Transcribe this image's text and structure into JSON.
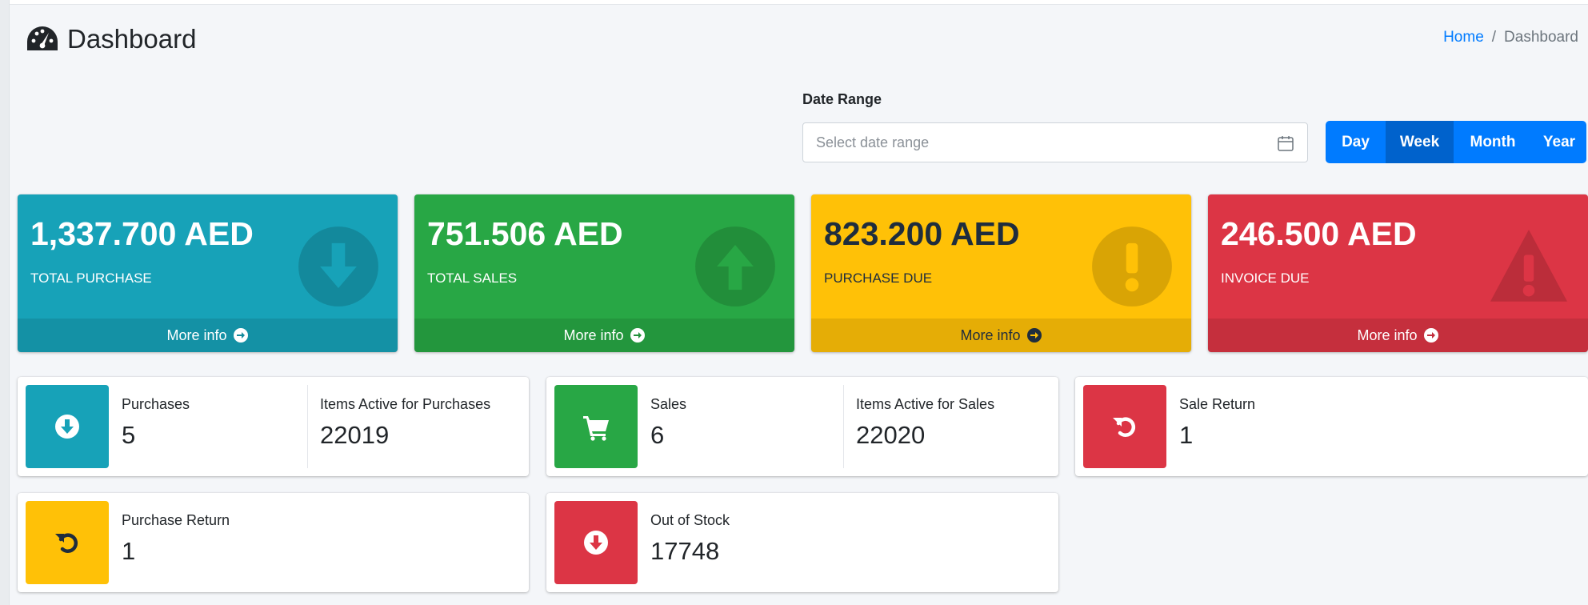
{
  "header": {
    "title": "Dashboard",
    "title_icon": "tachometer-icon",
    "breadcrumb": {
      "home": "Home",
      "separator": "/",
      "current": "Dashboard"
    }
  },
  "date_range": {
    "label": "Date Range",
    "placeholder": "Select date range",
    "icon": "calendar-icon",
    "buttons": [
      {
        "label": "Day",
        "active": false
      },
      {
        "label": "Week",
        "active": true
      },
      {
        "label": "Month",
        "active": false
      },
      {
        "label": "Year",
        "active": false
      }
    ],
    "accent_color": "#007bff"
  },
  "stat_boxes": [
    {
      "value": "1,337.700 AED",
      "label": "TOTAL PURCHASE",
      "footer": "More info",
      "icon": "arrow-circle-down-icon",
      "color": "#17a2b8"
    },
    {
      "value": "751.506 AED",
      "label": "TOTAL SALES",
      "footer": "More info",
      "icon": "arrow-circle-up-icon",
      "color": "#28a745"
    },
    {
      "value": "823.200 AED",
      "label": "PURCHASE DUE",
      "footer": "More info",
      "icon": "exclamation-circle-icon",
      "color": "#ffc107"
    },
    {
      "value": "246.500 AED",
      "label": "INVOICE DUE",
      "footer": "More info",
      "icon": "warning-triangle-icon",
      "color": "#dc3545"
    }
  ],
  "info_boxes": {
    "purchases": {
      "label": "Purchases",
      "value": "5",
      "secondary_label": "Items Active for Purchases",
      "secondary_value": "22019",
      "icon": "arrow-circle-down-icon",
      "color": "#17a2b8"
    },
    "sales": {
      "label": "Sales",
      "value": "6",
      "secondary_label": "Items Active for Sales",
      "secondary_value": "22020",
      "icon": "shopping-cart-icon",
      "color": "#28a745"
    },
    "sale_return": {
      "label": "Sale Return",
      "value": "1",
      "icon": "undo-icon",
      "color": "#dc3545"
    },
    "purchase_return": {
      "label": "Purchase Return",
      "value": "1",
      "icon": "undo-icon",
      "color": "#ffc107"
    },
    "out_of_stock": {
      "label": "Out of Stock",
      "value": "17748",
      "icon": "arrow-circle-down-icon",
      "color": "#dc3545"
    }
  }
}
